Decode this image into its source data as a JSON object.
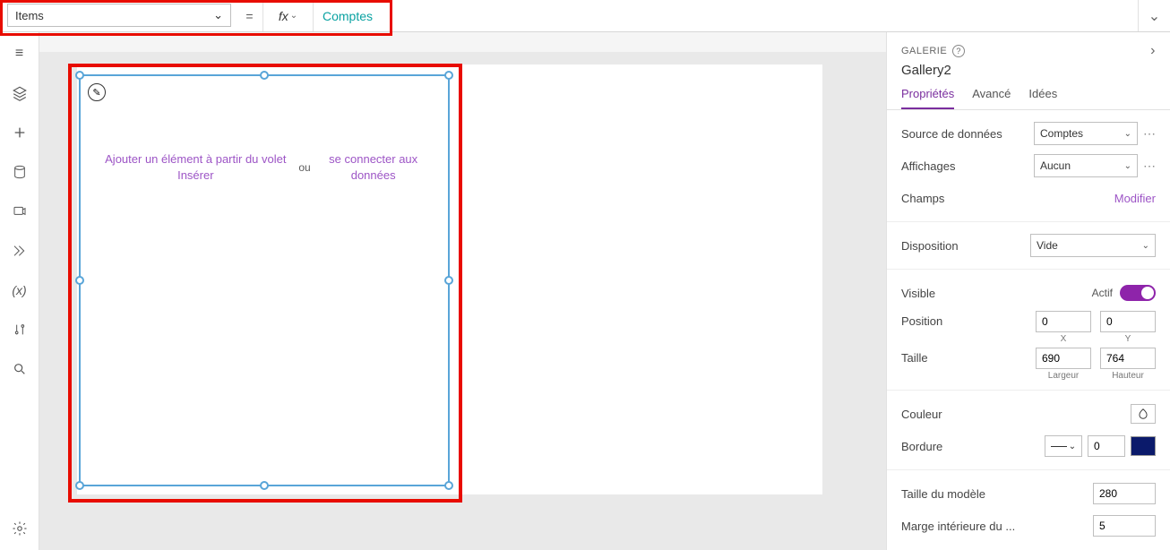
{
  "formula": {
    "property": "Items",
    "equals": "=",
    "fx": "fx",
    "value": "Comptes"
  },
  "canvas": {
    "hint_left": "Ajouter un élément à partir du volet Insérer",
    "hint_or": "ou",
    "hint_right": "se connecter aux données"
  },
  "panel": {
    "kind": "GALERIE",
    "name": "Gallery2",
    "tabs": {
      "props": "Propriétés",
      "advanced": "Avancé",
      "ideas": "Idées"
    },
    "dataSourceLabel": "Source de données",
    "dataSourceValue": "Comptes",
    "viewsLabel": "Affichages",
    "viewsValue": "Aucun",
    "fieldsLabel": "Champs",
    "fieldsAction": "Modifier",
    "layoutLabel": "Disposition",
    "layoutValue": "Vide",
    "visibleLabel": "Visible",
    "visibleState": "Actif",
    "positionLabel": "Position",
    "posX": "0",
    "posY": "0",
    "posXLabel": "X",
    "posYLabel": "Y",
    "sizeLabel": "Taille",
    "width": "690",
    "height": "764",
    "widthLabel": "Largeur",
    "heightLabel": "Hauteur",
    "colorLabel": "Couleur",
    "borderLabel": "Bordure",
    "borderWidth": "0",
    "templateSizeLabel": "Taille du modèle",
    "templateSize": "280",
    "paddingLabel": "Marge intérieure du ...",
    "padding": "5"
  }
}
